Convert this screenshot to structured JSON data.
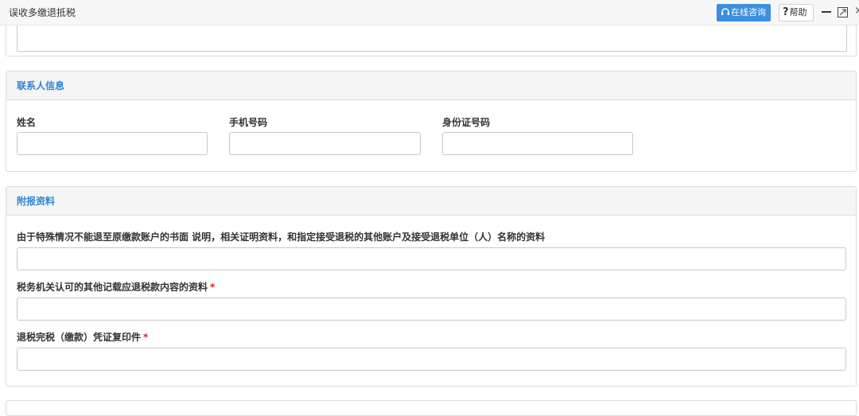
{
  "window": {
    "title": "误收多缴退抵税",
    "online_consult": "在线咨询",
    "help_label": "帮助",
    "help_mark": "?",
    "close_glyph": "×"
  },
  "contact": {
    "section_title": "联系人信息",
    "name_label": "姓名",
    "name_value": "",
    "phone_label": "手机号码",
    "phone_value": "",
    "id_label": "身份证号码",
    "id_value": ""
  },
  "attachments": {
    "section_title": "附报资料",
    "doc1_label": "由于特殊情况不能退至原缴款账户的书面 说明，相关证明资料，和指定接受退税的其他账户及接受退税单位（人）名称的资料",
    "doc1_value": "",
    "doc2_label": "税务机关认可的其他记载应退税款内容的资料",
    "doc2_required": "*",
    "doc2_value": "",
    "doc3_label": "退税完税（缴款）凭证复印件",
    "doc3_required": "*",
    "doc3_value": ""
  },
  "colors": {
    "accent": "#2f84d8",
    "button_blue": "#3c8fe0",
    "required": "#e02020"
  }
}
